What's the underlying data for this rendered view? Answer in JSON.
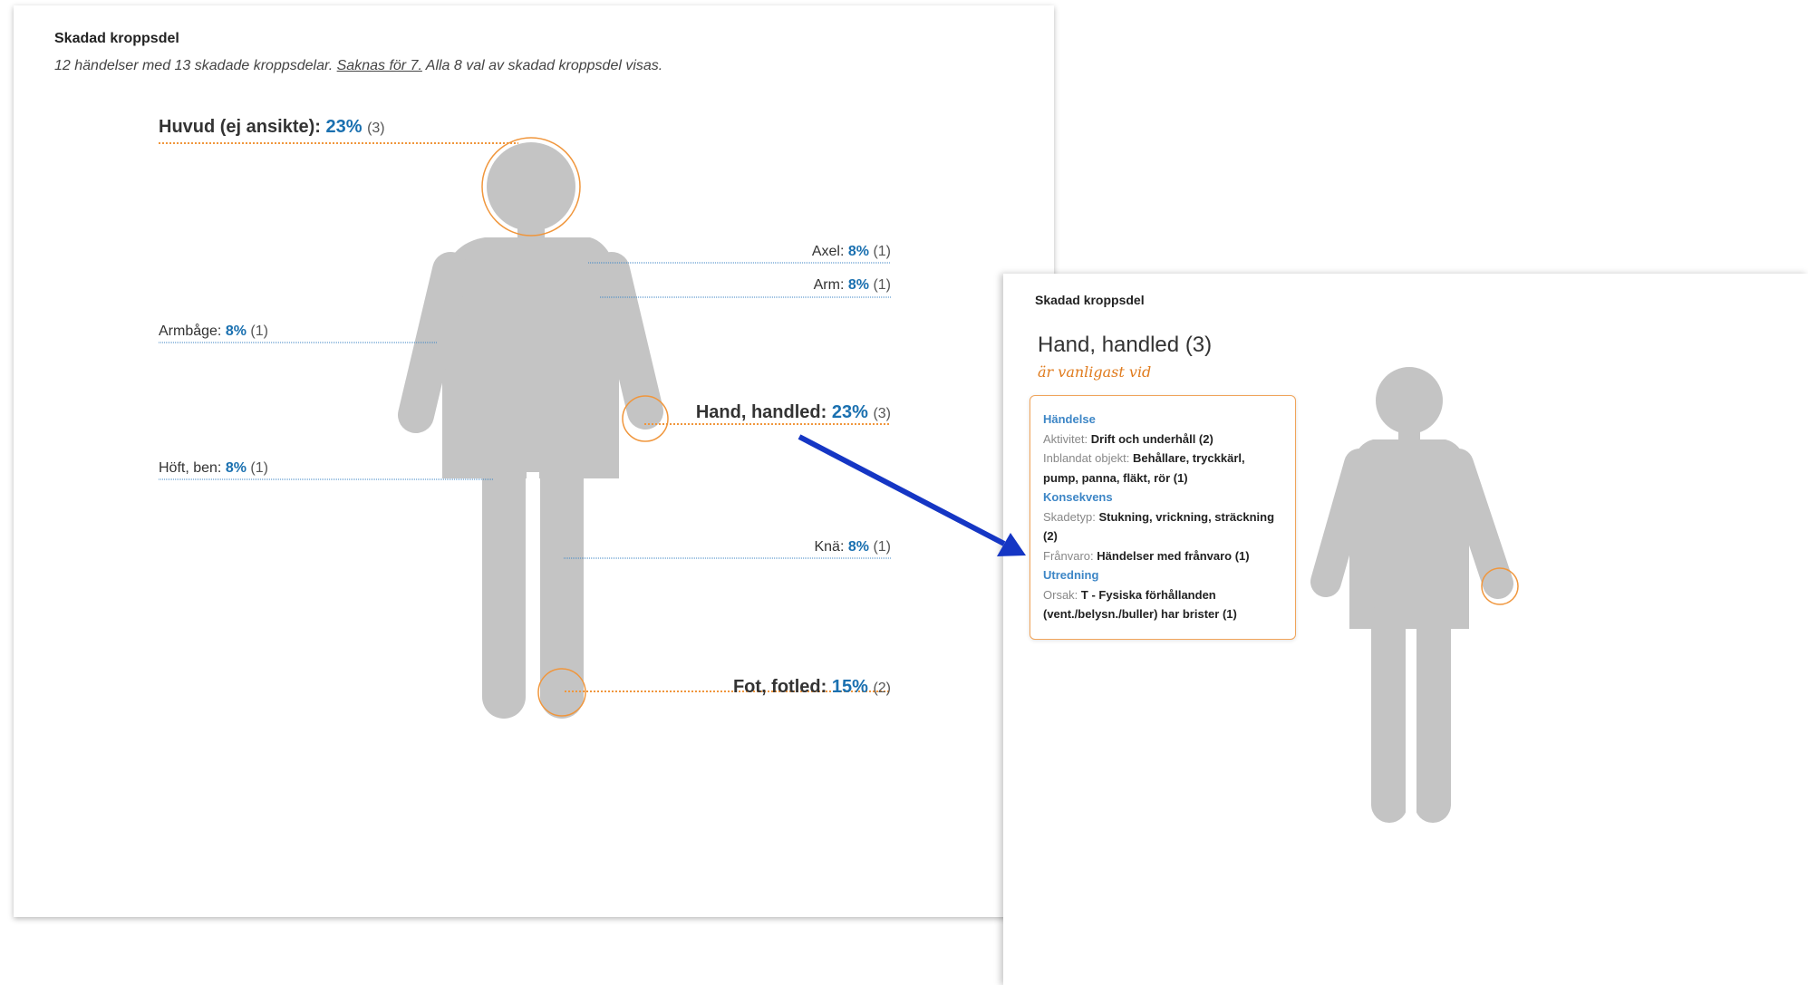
{
  "panel1": {
    "title": "Skadad kroppsdel",
    "summary": {
      "prefix": "12 händelser med 13 skadade kroppsdelar.",
      "missing_link": "Saknas för 7.",
      "suffix": "Alla 8 val av skadad kroppsdel visas."
    },
    "labels": {
      "head": {
        "name": "Huvud (ej ansikte):",
        "pct": "23%",
        "count": "(3)"
      },
      "shoulder": {
        "name": "Axel:",
        "pct": "8%",
        "count": "(1)"
      },
      "arm": {
        "name": "Arm:",
        "pct": "8%",
        "count": "(1)"
      },
      "elbow": {
        "name": "Armbåge:",
        "pct": "8%",
        "count": "(1)"
      },
      "hand": {
        "name": "Hand, handled:",
        "pct": "23%",
        "count": "(3)"
      },
      "hip": {
        "name": "Höft, ben:",
        "pct": "8%",
        "count": "(1)"
      },
      "knee": {
        "name": "Knä:",
        "pct": "8%",
        "count": "(1)"
      },
      "foot": {
        "name": "Fot, fotled:",
        "pct": "15%",
        "count": "(2)"
      }
    }
  },
  "panel2": {
    "title": "Skadad kroppsdel",
    "heading": "Hand, handled",
    "heading_count": "(3)",
    "subheading": "är vanligast vid",
    "info": {
      "section_event": "Händelse",
      "activity_label": "Aktivitet:",
      "activity_value": "Drift och underhåll (2)",
      "object_label": "Inblandat objekt:",
      "object_value": "Behållare, tryckkärl, pump, panna, fläkt, rör (1)",
      "section_consequence": "Konsekvens",
      "injury_label": "Skadetyp:",
      "injury_value": "Stukning, vrickning, sträckning (2)",
      "absence_label": "Frånvaro:",
      "absence_value": "Händelser med frånvaro (1)",
      "section_investigation": "Utredning",
      "cause_label": "Orsak:",
      "cause_value": "T - Fysiska förhållanden (vent./belysn./buller) har brister (1)"
    }
  },
  "colors": {
    "figure": "#c4c4c4",
    "highlight": "#f0963c",
    "blue_value": "#1a70b0",
    "blue_line": "#3d86c6",
    "arrow": "#1536c4"
  }
}
